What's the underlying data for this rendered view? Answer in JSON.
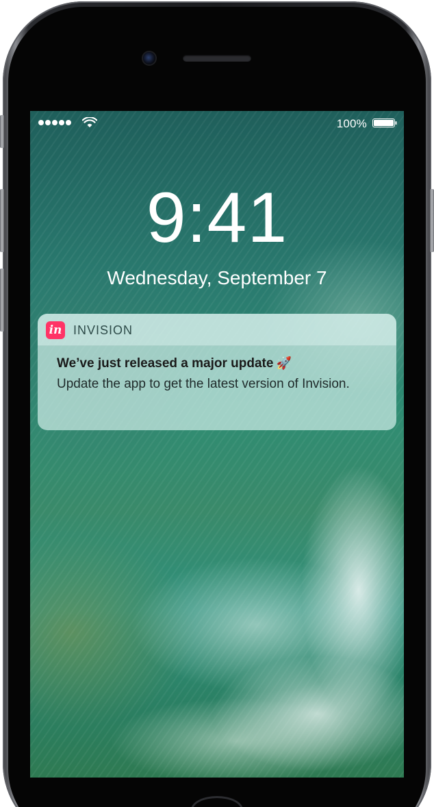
{
  "status_bar": {
    "signal_dots": 5,
    "wifi_icon": "wifi-icon",
    "battery_percent": "100%",
    "battery_icon": "battery-icon",
    "battery_level": 1.0
  },
  "lock_screen": {
    "time": "9:41",
    "date": "Wednesday, September 7"
  },
  "notification": {
    "app_icon_text": "in",
    "app_icon_color": "#ff3366",
    "app_name": "INVISION",
    "title": "We’ve just released a major update",
    "title_emoji": "🚀",
    "body": "Update the app to get the latest version of Invision."
  }
}
